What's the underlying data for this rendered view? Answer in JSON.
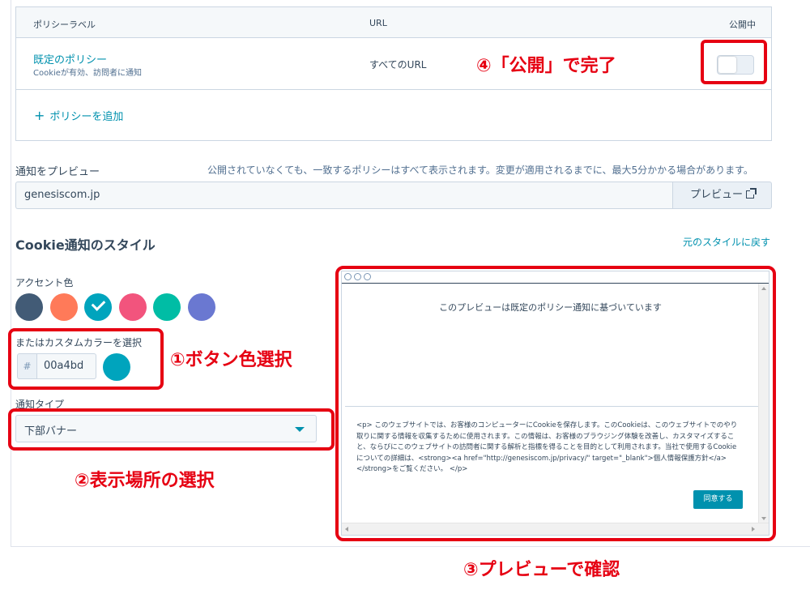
{
  "policy_table": {
    "headers": {
      "label": "ポリシーラベル",
      "url": "URL",
      "published": "公開中"
    },
    "rows": [
      {
        "name": "既定のポリシー",
        "description": "Cookieが有効、訪問者に通知",
        "url": "すべてのURL",
        "published": false
      }
    ],
    "add_policy_label": "ポリシーを追加"
  },
  "preview_url": {
    "label": "通知をプレビュー",
    "note": "公開されていなくても、一致するポリシーはすべて表示されます。変更が適用されるまでに、最大5分かかる場合があります。",
    "value": "genesiscom.jp",
    "button_label": "プレビュー"
  },
  "style_section": {
    "title": "Cookie通知のスタイル",
    "reset_link": "元のスタイルに戻す",
    "accent_label": "アクセント色",
    "accent_colors": [
      "#425b76",
      "#ff7a59",
      "#00a4bd",
      "#f2547d",
      "#00bda5",
      "#6a78d1"
    ],
    "selected_accent_index": 2,
    "custom_color_label": "またはカスタムカラーを選択",
    "hash_symbol": "#",
    "custom_color_value": "00a4bd",
    "custom_color_hex": "#00a4bd",
    "notice_type_label": "通知タイプ",
    "notice_type_value": "下部バナー"
  },
  "annotations": {
    "step1": "①ボタン色選択",
    "step2": "②表示場所の選択",
    "step3": "③プレビューで確認",
    "step4": "④「公開」で完了",
    "highlight_color": "#e60012"
  },
  "preview_window": {
    "caption": "このプレビューは既定のポリシー通知に基づいています",
    "body": "<p> このウェブサイトでは、お客様のコンピューターにCookieを保存します。このCookieは、このウェブサイトでのやり取りに関する情報を収集するために使用されます。この情報は、お客様のブラウジング体験を改善し、カスタマイズすること、ならびにこのウェブサイトの訪問者に関する解析と指標を得ることを目的として利用されます。当社で使用するCookieについての詳細は、<strong><a href=\"http://genesiscom.jp/privacy/\" target=\"_blank\">個人情報保護方針</a></strong>をご覧ください。 </p>",
    "agree_button": "同意する"
  }
}
